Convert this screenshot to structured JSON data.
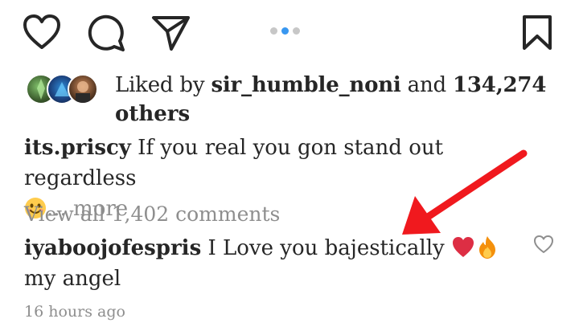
{
  "actions": {
    "like": "heart-icon",
    "comment": "comment-icon",
    "share": "send-icon",
    "save": "bookmark-icon",
    "carousel": {
      "count": 3,
      "active_index": 1
    }
  },
  "likes": {
    "prefix": "Liked by ",
    "user": "sir_humble_noni",
    "middle": " and ",
    "count": "134,274",
    "suffix": "others"
  },
  "caption": {
    "username": "its.priscy",
    "text": " If you real you gon stand out regardless",
    "emoji": "smiling-face-emoji",
    "more": "... more"
  },
  "view_comments": "View all 1,402 comments",
  "comment": {
    "username": "iyaboojofespris",
    "text": " I Love you bajestically ",
    "emojis": [
      "red-heart-emoji",
      "fire-emoji"
    ],
    "line2": "my angel"
  },
  "timestamp": "16 hours ago",
  "colors": {
    "text": "#262626",
    "muted": "#8e8e8e",
    "accent": "#3897f0",
    "annotation": "#f0191e"
  }
}
